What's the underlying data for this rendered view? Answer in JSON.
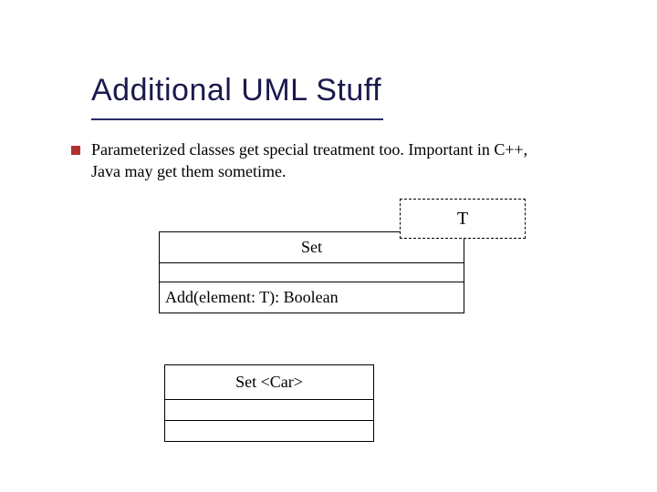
{
  "title": "Additional UML Stuff",
  "description": "Parameterized classes get special treatment too. Important in C++, Java may get them sometime.",
  "template_param": "T",
  "uml1": {
    "name": "Set",
    "operation": "Add(element: T): Boolean"
  },
  "uml2": {
    "name": "Set <Car>"
  }
}
